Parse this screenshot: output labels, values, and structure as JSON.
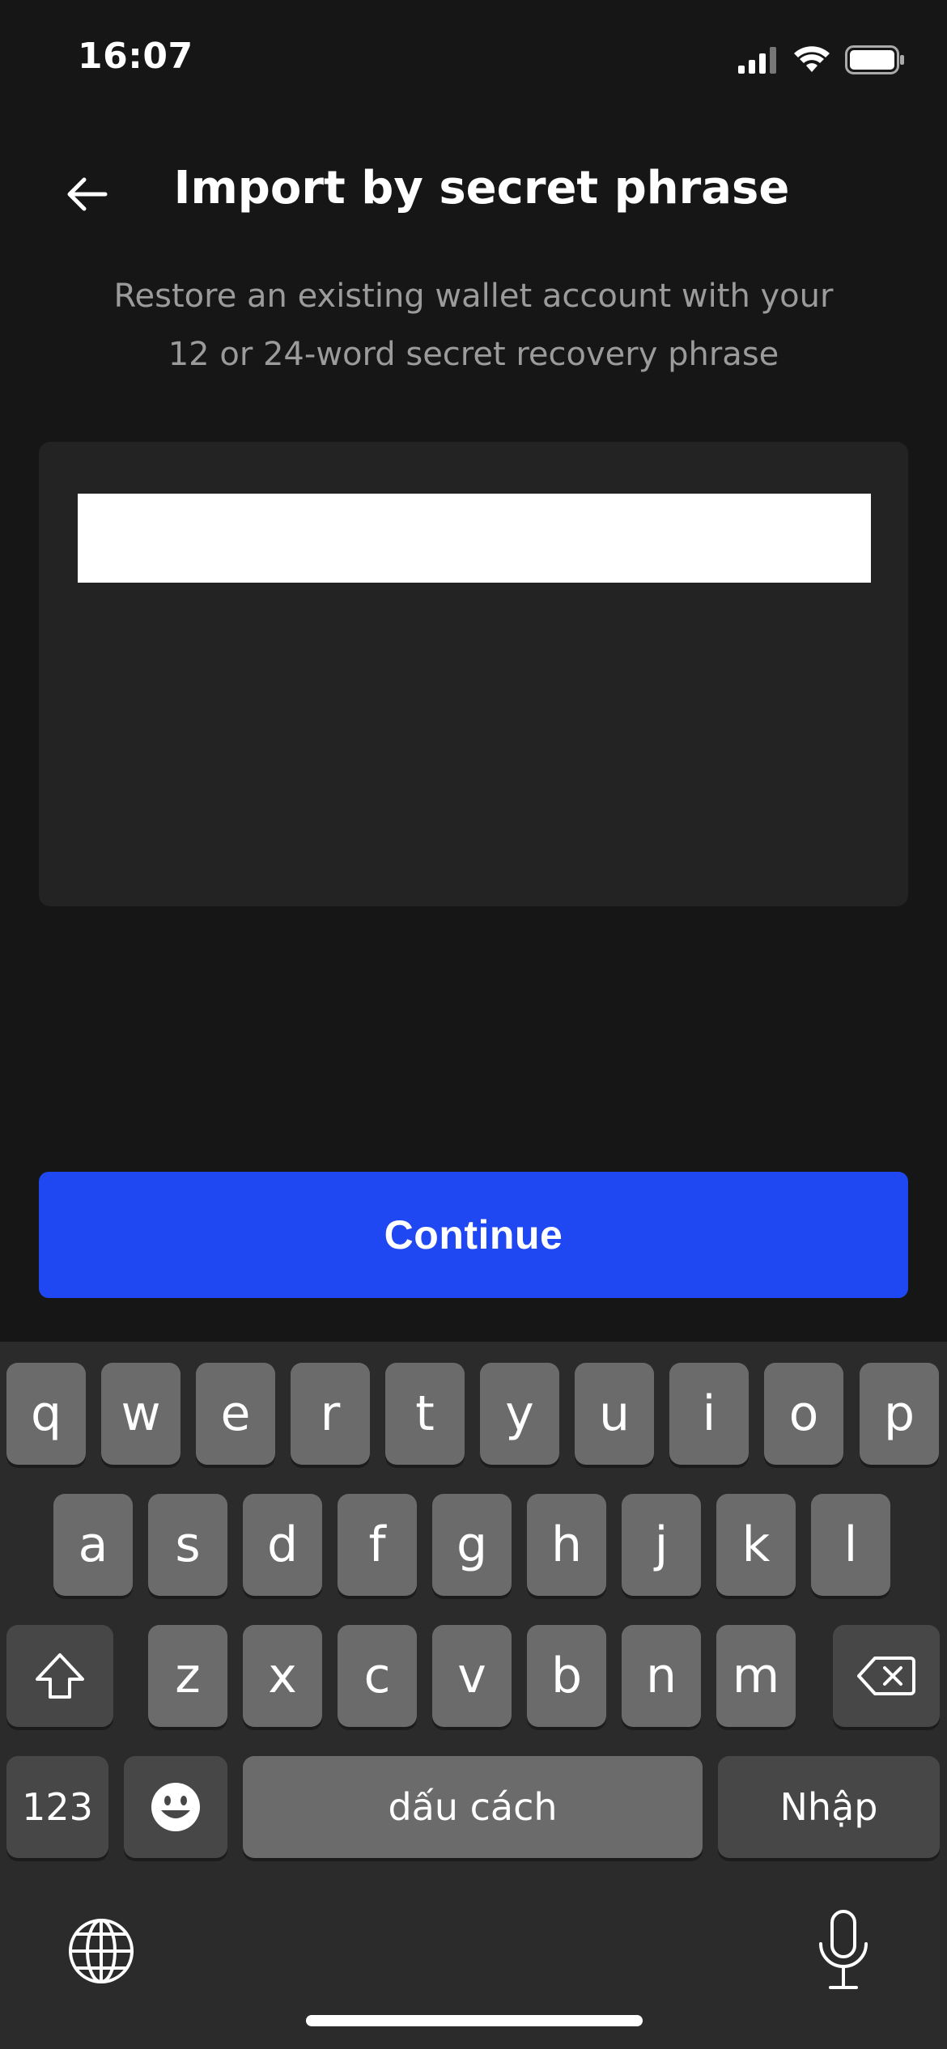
{
  "status_bar": {
    "time": "16:07"
  },
  "header": {
    "title": "Import by secret phrase",
    "subtitle": "Restore an existing wallet account with your\n12 or 24-word secret recovery phrase"
  },
  "phrase_input": {
    "value": ""
  },
  "actions": {
    "continue_label": "Continue"
  },
  "keyboard": {
    "row1": [
      "q",
      "w",
      "e",
      "r",
      "t",
      "y",
      "u",
      "i",
      "o",
      "p"
    ],
    "row2": [
      "a",
      "s",
      "d",
      "f",
      "g",
      "h",
      "j",
      "k",
      "l"
    ],
    "row3": [
      "z",
      "x",
      "c",
      "v",
      "b",
      "n",
      "m"
    ],
    "numbers_label": "123",
    "space_label": "dấu cách",
    "return_label": "Nhập"
  },
  "colors": {
    "accent": "#1f47f2",
    "background": "#161616",
    "field": "#232323"
  }
}
